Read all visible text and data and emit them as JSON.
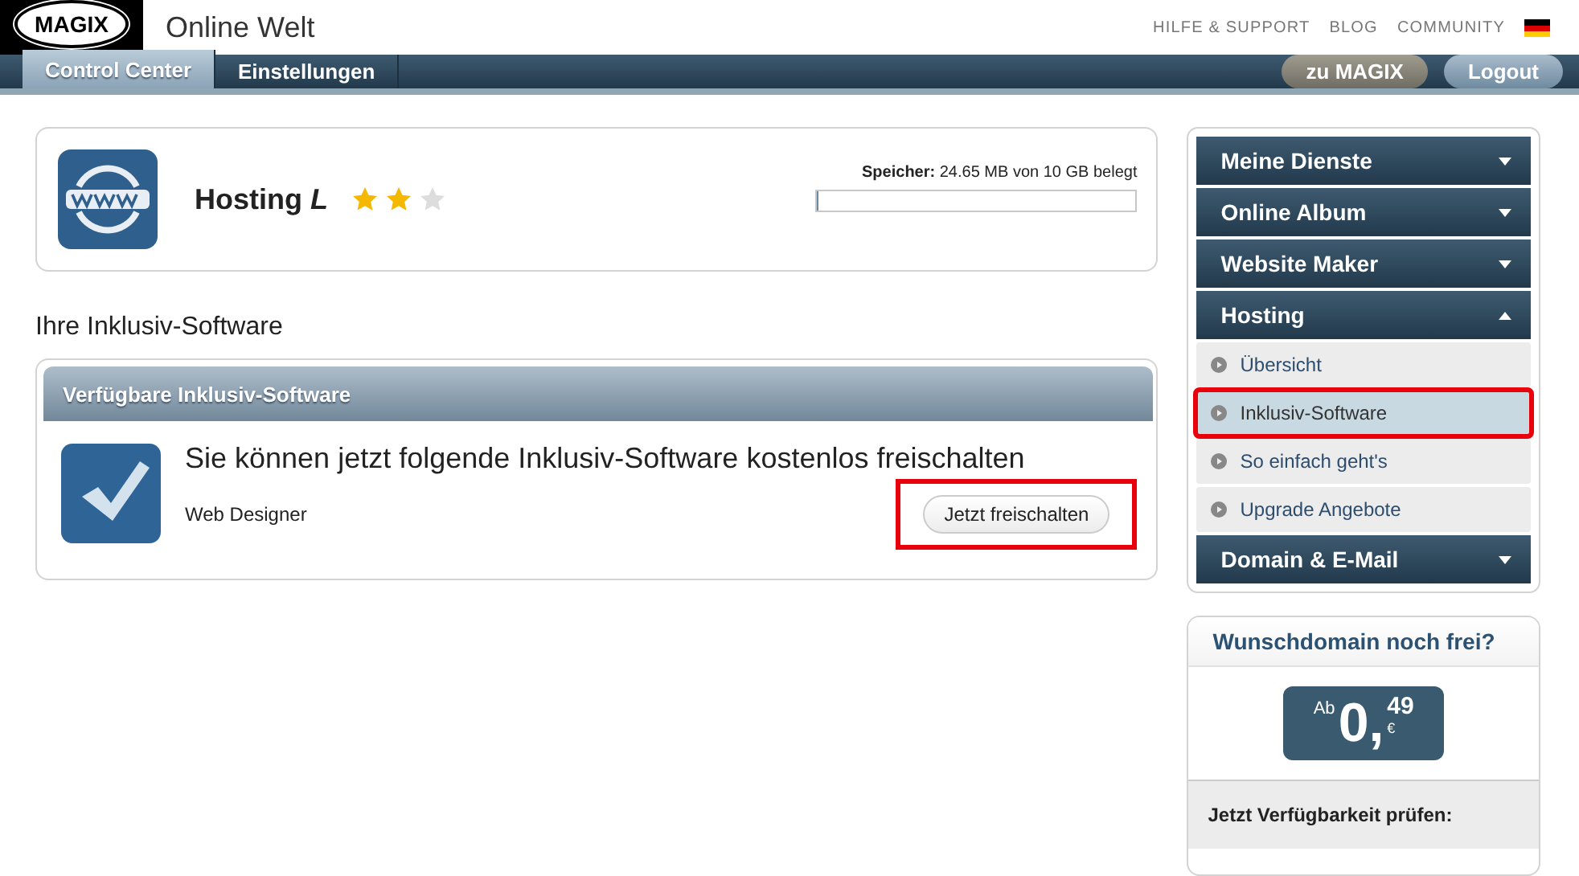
{
  "header": {
    "logo": "MAGIX",
    "title": "Online Welt",
    "links": [
      "HILFE & SUPPORT",
      "BLOG",
      "COMMUNITY"
    ]
  },
  "nav": {
    "tabs": [
      {
        "label": "Control Center",
        "selected": true
      },
      {
        "label": "Einstellungen",
        "selected": false
      }
    ],
    "buttons": [
      {
        "label": "zu MAGIX",
        "kind": "brand"
      },
      {
        "label": "Logout",
        "kind": "plain"
      }
    ]
  },
  "product": {
    "name": "Hosting",
    "variant": "L",
    "stars": 2,
    "storage_label": "Speicher:",
    "storage_text": "24.65 MB von 10 GB belegt",
    "level": 0.003
  },
  "section_title": "Ihre Inklusiv-Software",
  "software_panel": {
    "title": "Verfügbare Inklusiv-Software",
    "message": "Sie können jetzt folgende Inklusiv-Software kostenlos freischalten",
    "item": "Web Designer",
    "button": {
      "label": "Jetzt freischalten",
      "highlighted": true
    }
  },
  "sidebar": {
    "items": [
      {
        "label": "Meine Dienste",
        "expanded": false
      },
      {
        "label": "Online Album",
        "expanded": false
      },
      {
        "label": "Website Maker",
        "expanded": false
      },
      {
        "label": "Hosting",
        "expanded": true,
        "children": [
          {
            "label": "Übersicht",
            "selected": false,
            "highlighted": false
          },
          {
            "label": "Inklusiv-Software",
            "selected": true,
            "highlighted": true
          },
          {
            "label": "So einfach geht's",
            "selected": false,
            "highlighted": false
          },
          {
            "label": "Upgrade Angebote",
            "selected": false,
            "highlighted": false
          }
        ]
      },
      {
        "label": "Domain & E-Mail",
        "expanded": false
      }
    ]
  },
  "domain_box": {
    "title": "Wunschdomain noch frei?",
    "price_prefix": "Ab",
    "price_main": "0,",
    "price_cents": "49",
    "currency": "€",
    "footer": "Jetzt Verfügbarkeit prüfen:"
  }
}
